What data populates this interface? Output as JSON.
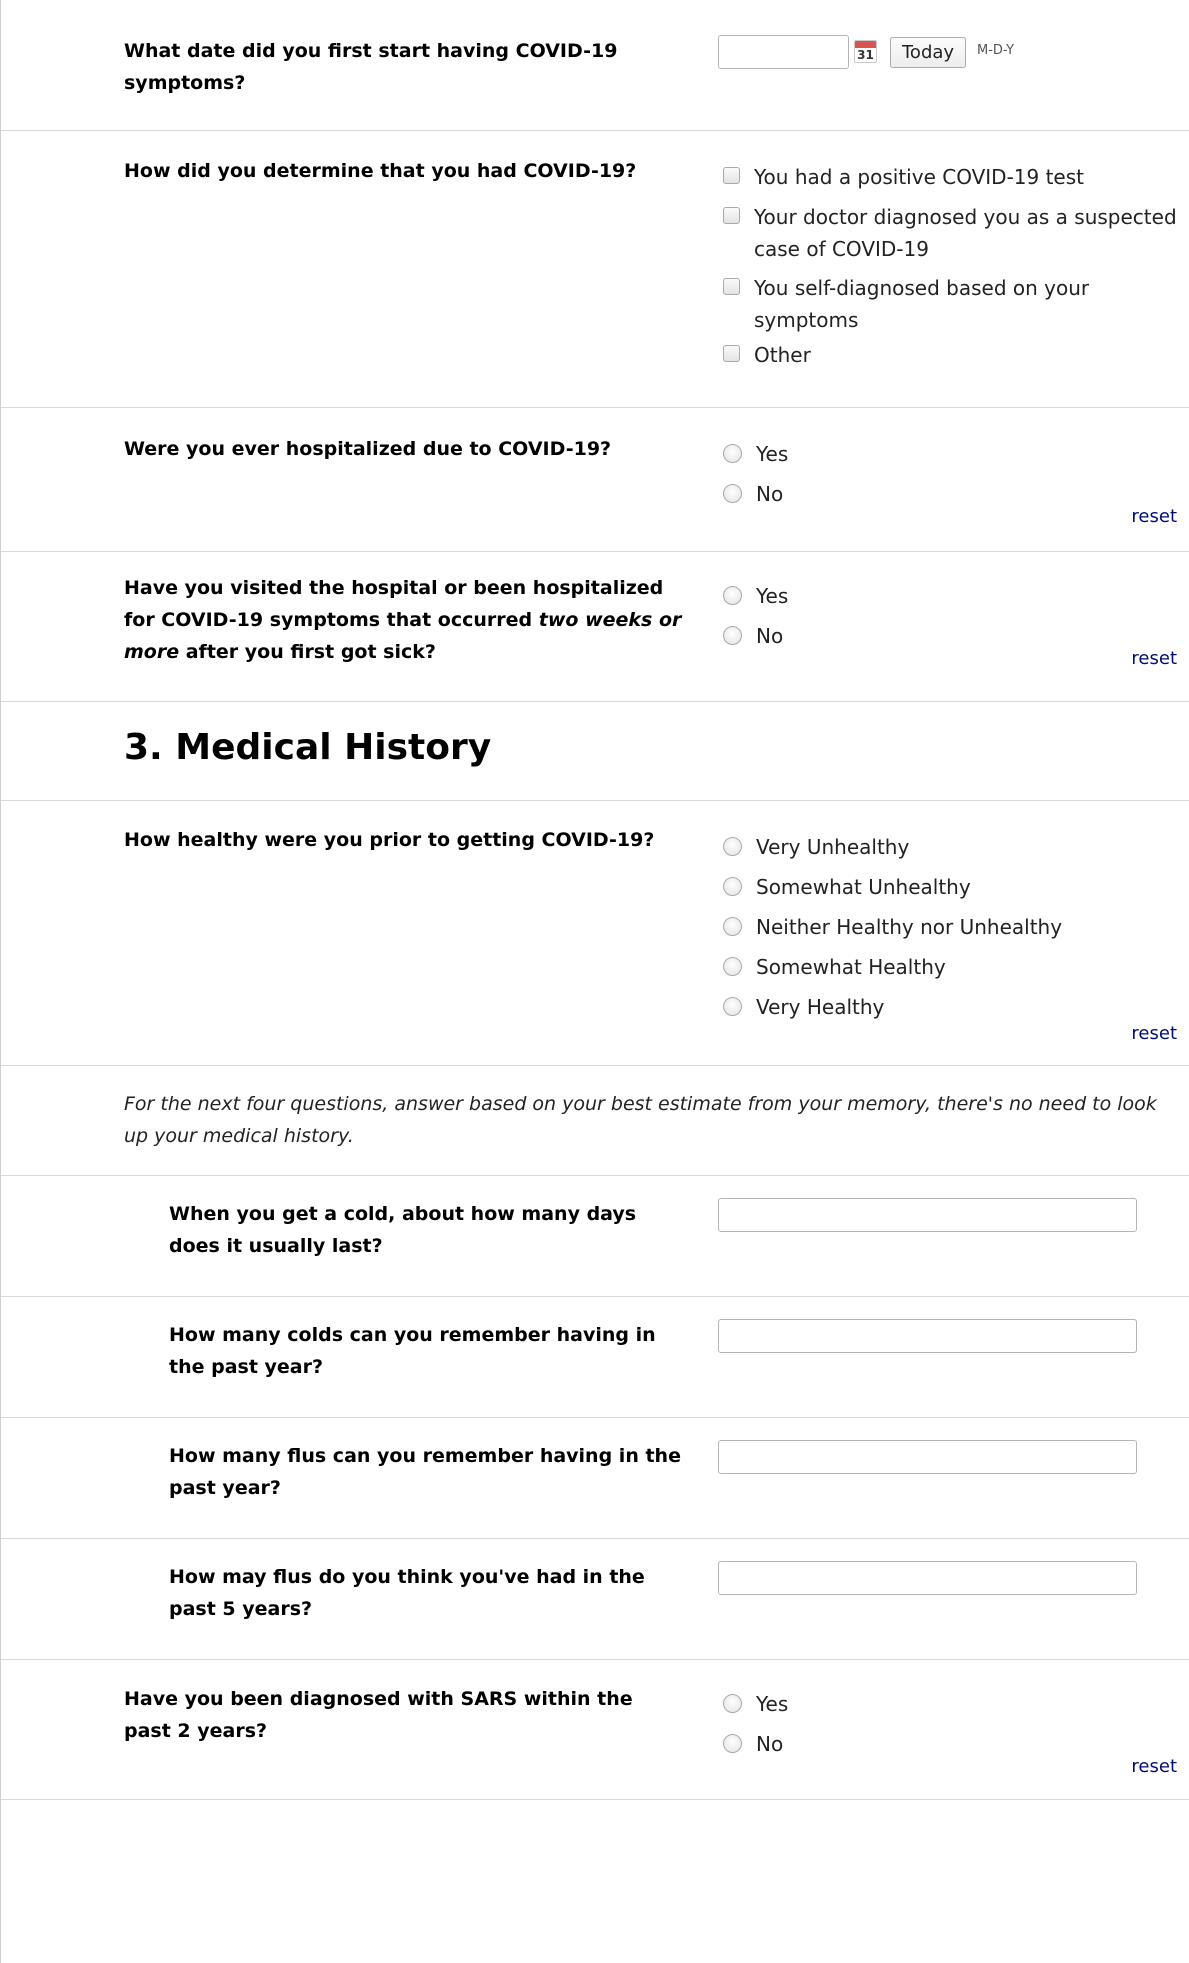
{
  "q_onset": {
    "label": "What date did you first start having COVID-19 symptoms?",
    "calendar_day": "31",
    "today_label": "Today",
    "format_hint": "M-D-Y"
  },
  "q_determine": {
    "label": "How did you determine that you had COVID-19?",
    "options": [
      "You had a positive COVID-19 test",
      "Your doctor diagnosed you as a suspected case of COVID-19",
      "You self-diagnosed based on your symptoms",
      "Other"
    ]
  },
  "q_hospitalized": {
    "label": "Were you ever hospitalized due to COVID-19?",
    "options": [
      "Yes",
      "No"
    ],
    "reset": "reset"
  },
  "q_late_visit": {
    "label_before": "Have you visited the hospital or been hospitalized for COVID-19 symptoms that occurred",
    "label_em": "two weeks or more",
    "label_after": "after you first got sick?",
    "options": [
      "Yes",
      "No"
    ],
    "reset": "reset"
  },
  "section3": {
    "title": "3. Medical History"
  },
  "q_health": {
    "label": "How healthy were you prior to getting COVID-19?",
    "options": [
      "Very Unhealthy",
      "Somewhat Unhealthy",
      "Neither Healthy nor Unhealthy",
      "Somewhat Healthy",
      "Very Healthy"
    ],
    "reset": "reset"
  },
  "note": "For the next four questions, answer based on your best estimate from your memory, there's no need to look up your medical history.",
  "q_cold_days": {
    "label": "When you get a cold, about how many days does it usually last?",
    "value": ""
  },
  "q_colds_year": {
    "label": "How many colds can you remember having in the past year?",
    "value": ""
  },
  "q_flus_year": {
    "label": "How many flus can you remember having in the past year?",
    "value": ""
  },
  "q_flus_5yr": {
    "label": "How may flus do you think you've had in the past 5 years?",
    "value": ""
  },
  "q_sars": {
    "label": "Have you been diagnosed with SARS within the past 2 years?",
    "options": [
      "Yes",
      "No"
    ],
    "reset": "reset"
  }
}
